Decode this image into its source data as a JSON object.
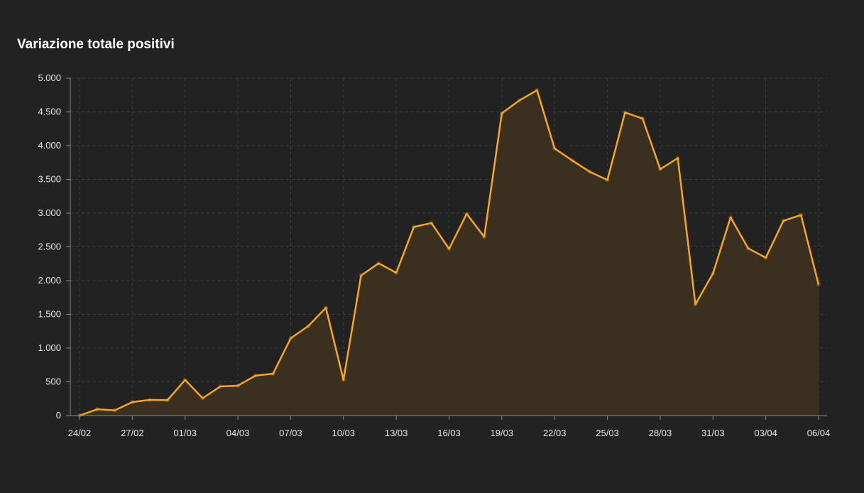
{
  "chart_data": {
    "type": "area",
    "title": "Variazione totale positivi",
    "xlabel": "",
    "ylabel": "",
    "x": [
      "24/02",
      "25/02",
      "26/02",
      "27/02",
      "28/02",
      "29/02",
      "01/03",
      "02/03",
      "03/03",
      "04/03",
      "05/03",
      "06/03",
      "07/03",
      "08/03",
      "09/03",
      "10/03",
      "11/03",
      "12/03",
      "13/03",
      "14/03",
      "15/03",
      "16/03",
      "17/03",
      "18/03",
      "19/03",
      "20/03",
      "21/03",
      "22/03",
      "23/03",
      "24/03",
      "25/03",
      "26/03",
      "27/03",
      "28/03",
      "29/03",
      "30/03",
      "31/03",
      "01/04",
      "02/04",
      "03/04",
      "04/04",
      "05/04",
      "06/04"
    ],
    "x_tick_labels": [
      "24/02",
      "27/02",
      "01/03",
      "04/03",
      "07/03",
      "10/03",
      "13/03",
      "16/03",
      "19/03",
      "22/03",
      "25/03",
      "28/03",
      "31/03",
      "03/04",
      "06/04"
    ],
    "series": [
      {
        "values": [
          0,
          93,
          78,
          200,
          233,
          229,
          528,
          258,
          431,
          443,
          592,
          620,
          1145,
          1326,
          1598,
          529,
          2076,
          2256,
          2116,
          2795,
          2853,
          2470,
          2989,
          2648,
          4480,
          4670,
          4821,
          3957,
          3780,
          3612,
          3491,
          4492,
          4401,
          3651,
          3815,
          1648,
          2107,
          2937,
          2477,
          2339,
          2886,
          2972,
          1941
        ]
      }
    ],
    "ylim": [
      0,
      5000
    ],
    "y_ticks": [
      0,
      500,
      1000,
      1500,
      2000,
      2500,
      3000,
      3500,
      4000,
      4500,
      5000
    ],
    "y_tick_labels": [
      "0",
      "500",
      "1.000",
      "1.500",
      "2.000",
      "2.500",
      "3.000",
      "3.500",
      "4.000",
      "4.500",
      "5.000"
    ],
    "grid": true,
    "colors": {
      "line": "#f5a623",
      "fill": "#3b3020",
      "background": "#222222",
      "grid": "#3a3a3a",
      "axis": "#888888",
      "text": "#e6e6e6",
      "title": "#ffffff"
    }
  }
}
